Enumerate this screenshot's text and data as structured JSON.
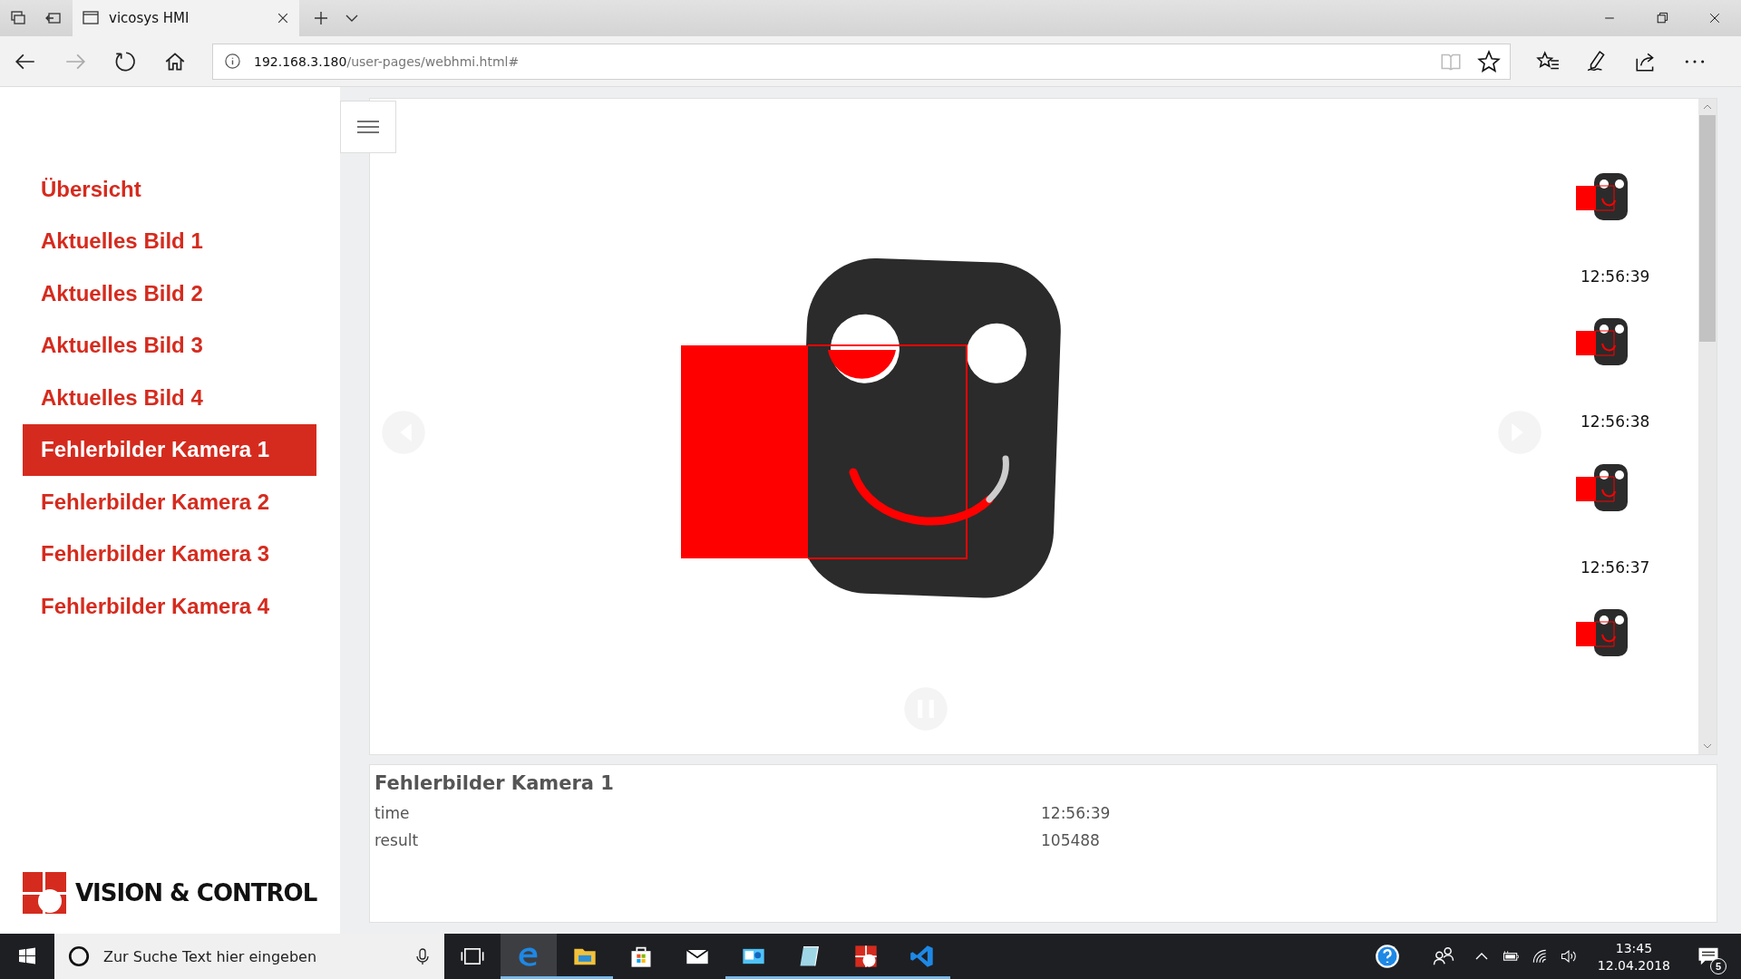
{
  "browser": {
    "tab_title": "vicosys HMI",
    "url_host": "192.168.3.180",
    "url_path": "/user-pages/webhmi.html#"
  },
  "sidebar": {
    "items": [
      {
        "label": "Übersicht",
        "selected": false
      },
      {
        "label": "Aktuelles Bild 1",
        "selected": false
      },
      {
        "label": "Aktuelles Bild 2",
        "selected": false
      },
      {
        "label": "Aktuelles Bild 3",
        "selected": false
      },
      {
        "label": "Aktuelles Bild 4",
        "selected": false
      },
      {
        "label": "Fehlerbilder Kamera 1",
        "selected": true
      },
      {
        "label": "Fehlerbilder Kamera 2",
        "selected": false
      },
      {
        "label": "Fehlerbilder Kamera 3",
        "selected": false
      },
      {
        "label": "Fehlerbilder Kamera 4",
        "selected": false
      }
    ],
    "logo_text": "VISION & CONTROL"
  },
  "thumbnails": [
    {
      "time": "12:56:39"
    },
    {
      "time": "12:56:38"
    },
    {
      "time": "12:56:37"
    }
  ],
  "info": {
    "title": "Fehlerbilder Kamera 1",
    "rows": [
      {
        "label": "time",
        "value": "12:56:39"
      },
      {
        "label": "result",
        "value": "105488"
      }
    ]
  },
  "taskbar": {
    "search_placeholder": "Zur Suche Text hier eingeben",
    "time": "13:45",
    "date": "12.04.2018",
    "notification_count": "5"
  }
}
